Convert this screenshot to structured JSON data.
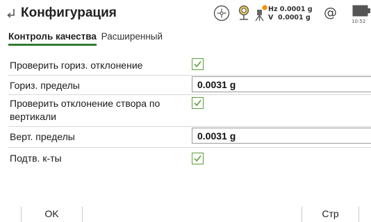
{
  "header": {
    "title": "Конфигурация",
    "hz_label": "Hz",
    "hz_value": "0.0001 g",
    "v_label": "V",
    "v_value": "0.0001 g",
    "at_symbol": "@",
    "time": "10:52",
    "icons": [
      "back-icon",
      "target-icon",
      "prism-icon",
      "instrument-icon",
      "at-icon",
      "battery-icon"
    ]
  },
  "tabs": [
    {
      "label": "Контроль качества",
      "active": true
    },
    {
      "label": "Расширенный",
      "active": false
    }
  ],
  "form": {
    "check_hz_label": "Проверить гориз. отклонение",
    "check_hz_checked": true,
    "hz_limits_label": "Гориз. пределы",
    "hz_limits_value": "0.0031 g",
    "check_v_label_line1": "Проверить отклонение створа по",
    "check_v_label_line2": "вертикали",
    "check_v_checked": true,
    "v_limits_label": "Верт. пределы",
    "v_limits_value": "0.0031 g",
    "confirm_label": "Подтв. к-ты",
    "confirm_checked": true
  },
  "softkeys": {
    "ok": "OK",
    "page": "Стр"
  },
  "colors": {
    "accent_green": "#2e7d32",
    "checkbox_green": "#5a9e3a",
    "badge_orange": "#f39200"
  }
}
